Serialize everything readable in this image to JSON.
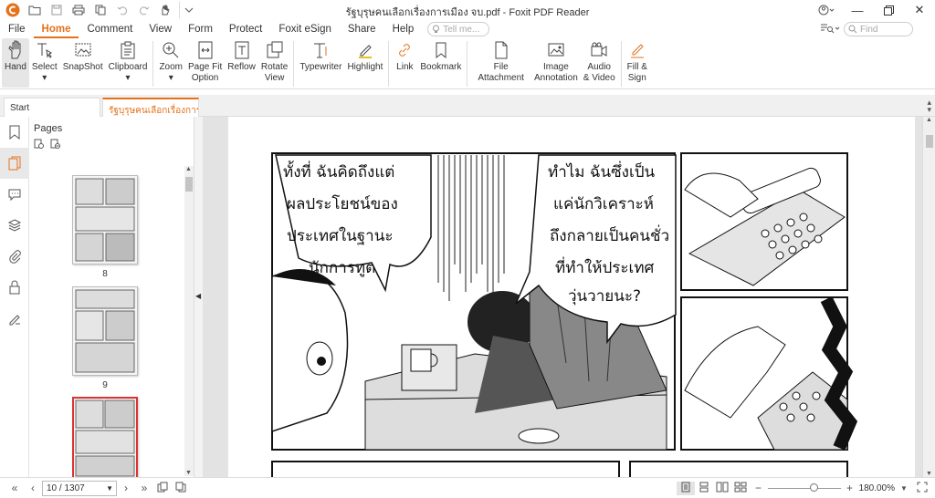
{
  "window": {
    "title": "รัฐบุรุษคนเลือกเรื่องการเมือง จบ.pdf - Foxit PDF Reader"
  },
  "menu": {
    "items": [
      "File",
      "Home",
      "Comment",
      "View",
      "Form",
      "Protect",
      "Foxit eSign",
      "Share",
      "Help"
    ],
    "active": "Home",
    "tell_me_placeholder": "Tell me..."
  },
  "find": {
    "placeholder": "Find"
  },
  "ribbon": {
    "hand": "Hand",
    "select": "Select",
    "snapshot": "SnapShot",
    "clipboard": "Clipboard",
    "zoom": "Zoom",
    "page_fit": "Page Fit",
    "page_fit2": "Option",
    "reflow": "Reflow",
    "rotate": "Rotate",
    "rotate2": "View",
    "typewriter": "Typewriter",
    "highlight": "Highlight",
    "link": "Link",
    "bookmark": "Bookmark",
    "file_attach": "File",
    "file_attach2": "Attachment",
    "image_annot": "Image",
    "image_annot2": "Annotation",
    "audio": "Audio",
    "audio2": "& Video",
    "fill_sign": "Fill &",
    "fill_sign2": "Sign"
  },
  "tabs": {
    "start": "Start",
    "doc": "รัฐบุรุษคนเลือกเรื่องการเมือ..."
  },
  "pages_panel": {
    "title": "Pages",
    "thumbs": [
      "8",
      "9"
    ]
  },
  "status": {
    "page": "10 / 1307",
    "zoom": "180.00%"
  },
  "comic": {
    "bubble1": [
      "ทั้งที่ ฉันคิดถึงแต่",
      "ผลประโยชน์ของ",
      "ประเทศในฐานะ",
      "นักการทูต"
    ],
    "bubble2": [
      "ทำไม ฉันซึ่งเป็น",
      "แค่นักวิเคราะห์",
      "ถึงกลายเป็นคนชั่ว",
      "ที่ทำให้ประเทศ",
      "วุ่นวายนะ?"
    ]
  },
  "colors": {
    "accent": "#e5721b",
    "selected_thumb": "#d33333"
  }
}
